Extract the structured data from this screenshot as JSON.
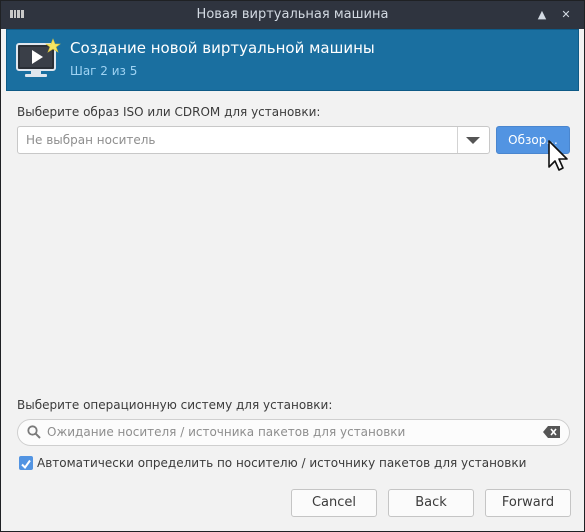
{
  "window": {
    "title": "Новая виртуальная машина"
  },
  "header": {
    "title": "Создание новой виртуальной машины",
    "step": "Шаг 2 из 5"
  },
  "install_media": {
    "label": "Выберите образ ISO или CDROM для установки:",
    "placeholder": "Не выбран носитель",
    "browse_label": "Обзор..."
  },
  "os_select": {
    "label": "Выберите операционную систему для установки:",
    "search_placeholder": "Ожидание носителя / источника пакетов для установки",
    "autodetect_label": "Автоматически определить по носителю / источнику пакетов для установки",
    "autodetect_checked": true
  },
  "footer": {
    "cancel_label": "Cancel",
    "back_label": "Back",
    "forward_label": "Forward"
  },
  "colors": {
    "header_bg": "#1a6fa0",
    "accent": "#5294e2",
    "titlebar_bg": "#2f343f"
  }
}
